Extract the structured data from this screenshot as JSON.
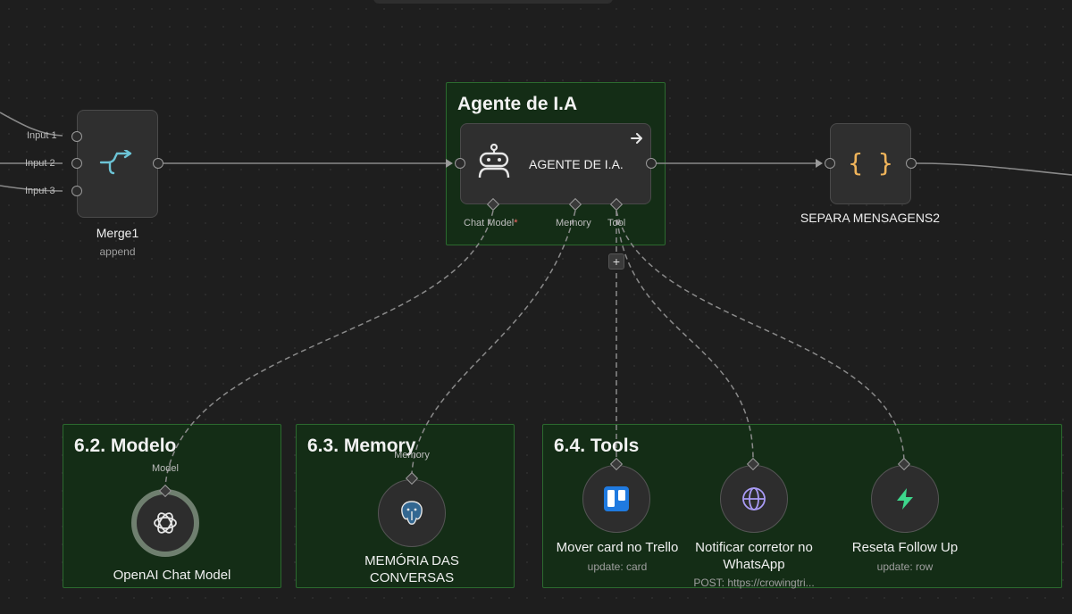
{
  "merge_node": {
    "title": "Merge1",
    "subtitle": "append",
    "inputs": [
      "Input 1",
      "Input 2",
      "Input 3"
    ]
  },
  "agent_sticky": {
    "title": "Agente de I.A"
  },
  "agent_node": {
    "title": "AGENTE DE I.A.",
    "ports": {
      "chat_model": "Chat Model",
      "required_mark": "*",
      "memory": "Memory",
      "tool": "Tool"
    },
    "add_label": "+"
  },
  "separa_node": {
    "title": "SEPARA MENSAGENS2",
    "icon_glyph": "{ }"
  },
  "modelo_sticky": {
    "title": "6.2. Modelo",
    "port_label": "Model",
    "node_title": "OpenAI Chat Model"
  },
  "memory_sticky": {
    "title": "6.3. Memory",
    "port_label": "Memory",
    "node_title_line1": "MEMÓRIA DAS",
    "node_title_line2": "CONVERSAS"
  },
  "tools_sticky": {
    "title": "6.4. Tools",
    "tools": [
      {
        "title": "Mover card no Trello",
        "subtitle": "update: card"
      },
      {
        "title_line1": "Notificar corretor no",
        "title_line2": "WhatsApp",
        "subtitle": "POST: https://crowingtri..."
      },
      {
        "title": "Reseta Follow Up",
        "subtitle": "update: row"
      }
    ]
  },
  "colors": {
    "background": "#1e1e1e",
    "sticky_fill": "#142d16",
    "sticky_border": "#2c6a2f",
    "merge_icon": "#6cc4d6",
    "braces_icon": "#f0b45a",
    "bolt_icon": "#3dd68c",
    "globe_icon": "#a99bf5",
    "trello_icon": "#1f7ae0"
  }
}
